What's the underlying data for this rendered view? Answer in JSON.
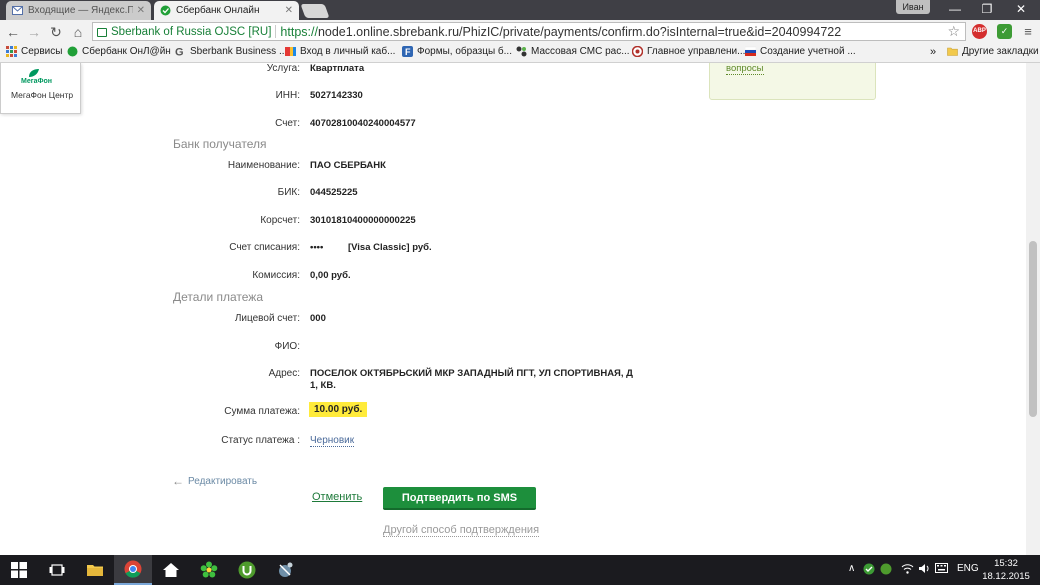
{
  "browser": {
    "tabs": [
      {
        "title": "Входящие — Яндекс.Почт",
        "active": false
      },
      {
        "title": "Сбербанк Онлайн",
        "active": true
      }
    ],
    "user": "Иван",
    "window_controls": {
      "minimize": "—",
      "restore": "❐",
      "close": "✕"
    },
    "ev_certificate": "Sberbank of Russia OJSC [RU]",
    "url_scheme": "https://",
    "url_rest": "node1.online.sbrebank.ru/PhizIC/private/payments/confirm.do?isInternal=true&id=2040994722",
    "ext_abp": "ABP"
  },
  "bookmarks": {
    "items": [
      "Сервисы",
      "Сбербанк ОнЛ@йн",
      "Sberbank Business ...",
      "Вход в личный каб...",
      "Формы, образцы б...",
      "Массовая СМС рас...",
      "Главное управлени...",
      "Создание учетной ...",
      "Другие закладки"
    ],
    "more": "»"
  },
  "sidebar": {
    "megafon_logo": "МегаФон",
    "megafon_caption": "МегаФон Центр"
  },
  "help_box": {
    "link": "вопросы"
  },
  "payment": {
    "service": {
      "label": "Услуга:",
      "value": "Квартплата"
    },
    "inn": {
      "label": "ИНН:",
      "value": "5027142330"
    },
    "account": {
      "label": "Счет:",
      "value": "40702810040240004577"
    },
    "bank_section": "Банк получателя",
    "bank_name": {
      "label": "Наименование:",
      "value": "ПАО СБЕРБАНК"
    },
    "bik": {
      "label": "БИК:",
      "value": "044525225"
    },
    "korr": {
      "label": "Корсчет:",
      "value": "30101810400000000225"
    },
    "debit": {
      "label": "Счет списания:",
      "value": "••••",
      "card": "[Visa Classic]  руб."
    },
    "commission": {
      "label": "Комиссия:",
      "value": "0,00 руб."
    },
    "details_section": "Детали платежа",
    "personal_account": {
      "label": "Лицевой счет:",
      "value": "000"
    },
    "fio": {
      "label": "ФИО:",
      "value": ""
    },
    "address": {
      "label": "Адрес:",
      "value": "ПОСЕЛОК ОКТЯБРЬСКИЙ МКР ЗАПАДНЫЙ ПГТ, УЛ СПОРТИВНАЯ, Д 1, КВ."
    },
    "amount": {
      "label": "Сумма платежа:",
      "value": "10.00 руб."
    },
    "status": {
      "label": "Статус платежа :",
      "value": "Черновик"
    }
  },
  "actions": {
    "edit": "Редактировать",
    "cancel": "Отменить",
    "confirm_sms": "Подтвердить по SMS",
    "other_confirm": "Другой способ подтверждения"
  },
  "taskbar": {
    "lang": "ENG",
    "time": "15:32",
    "date": "18.12.2015"
  },
  "colors": {
    "sber_green": "#1d8f3c",
    "highlight_yellow": "#ffeb3b",
    "link_blue": "#4a6a9a"
  }
}
